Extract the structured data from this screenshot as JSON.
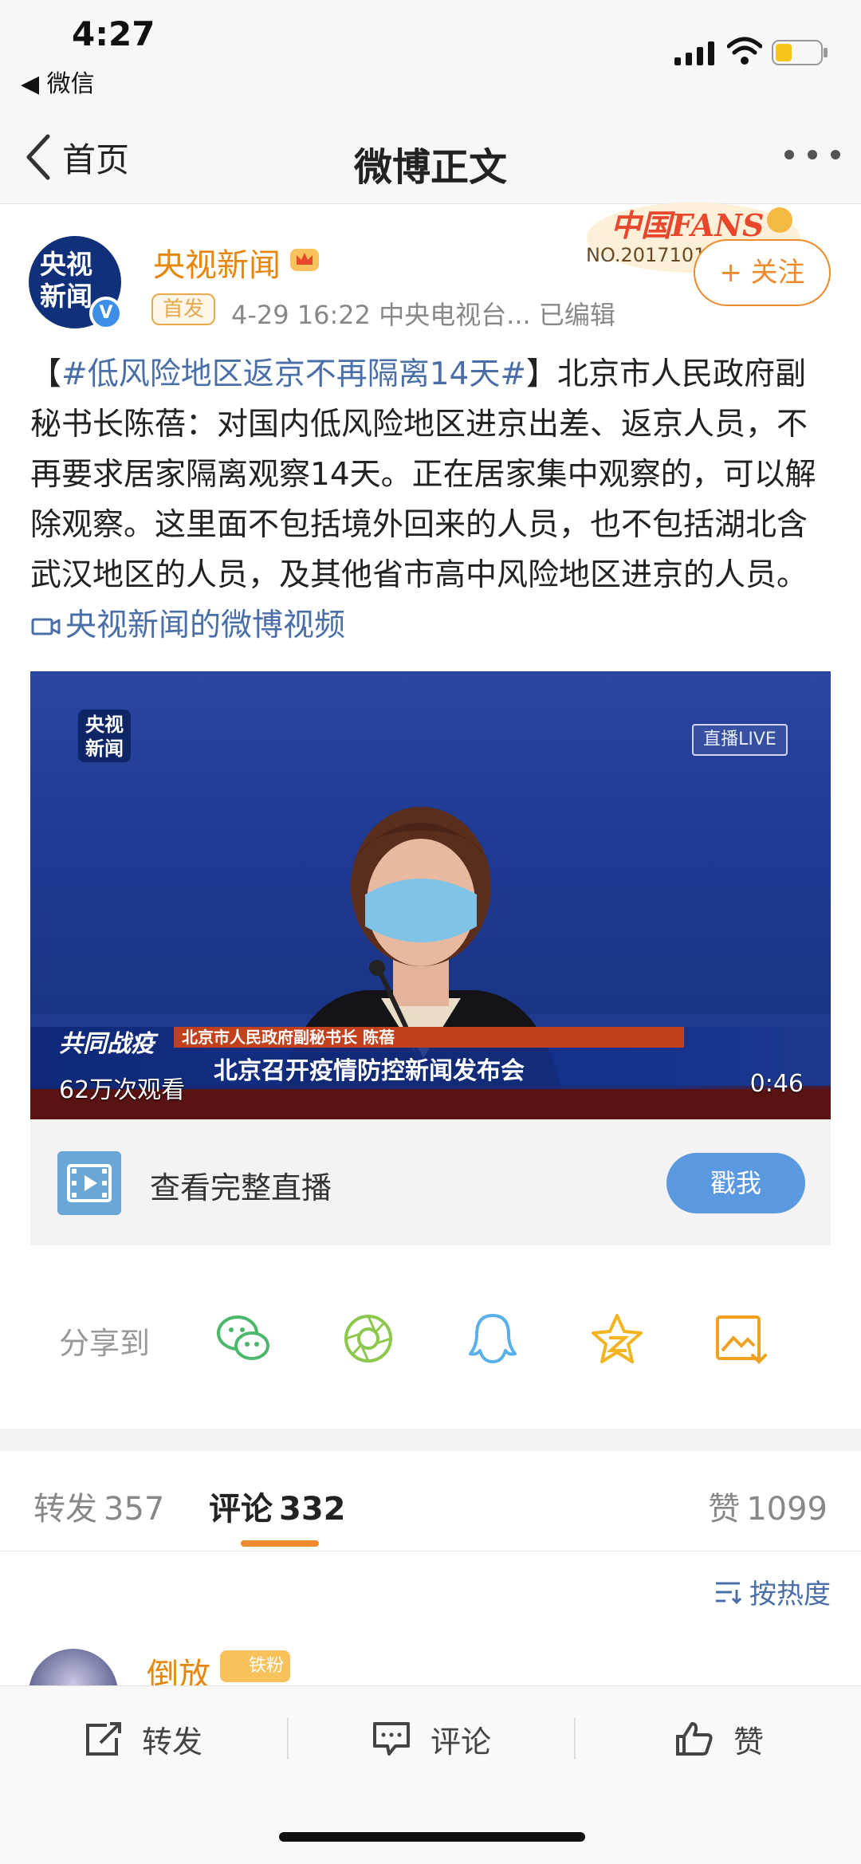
{
  "status": {
    "time": "4:27",
    "back_app": "◀ 微信"
  },
  "nav": {
    "back_label": "首页",
    "title": "微博正文"
  },
  "post": {
    "avatar_text": "央视新闻",
    "user_name": "央视新闻",
    "fans_badge_title": "中国FANS",
    "fans_badge_no": "NO.2017101",
    "follow_label": "+ 关注",
    "first_tag": "首发",
    "meta": "4-29 16:22  中央电视台...  已编辑",
    "text_open": "【",
    "hashtag": "#低风险地区返京不再隔离14天#",
    "text_close": "】北京市人民政府副秘书长陈蓓：对国内低风险地区进京出差、返京人员，不再要求居家隔离观察14天。正在居家集中观察的，可以解除观察。这里面不包括境外回来的人员，也不包括湖北含武汉地区的人员，及其他省市高中风险地区进京的人员。",
    "video_link": "央视新闻的微博视频"
  },
  "video": {
    "logo": "央视新闻",
    "live_tag": "直播LIVE",
    "lower_third_top": "北京市人民政府副秘书长 陈蓓",
    "lower_third_main": "北京召开疫情防控新闻发布会",
    "campaign": "共同战疫",
    "views": "62万次观看",
    "duration": "0:46"
  },
  "live_card": {
    "label": "查看完整直播",
    "button": "戳我"
  },
  "share": {
    "label": "分享到",
    "icons": [
      "wechat-icon",
      "moments-icon",
      "qq-icon",
      "qzone-icon",
      "save-image-icon"
    ]
  },
  "tabs": {
    "repost_label": "转发",
    "repost_count": "357",
    "comment_label": "评论",
    "comment_count": "332",
    "like_label": "赞",
    "like_count": "1099"
  },
  "sort_label": "按热度",
  "comment": {
    "user_name": "倒放",
    "badge": "铁粉"
  },
  "bottom": {
    "repost": "转发",
    "comment": "评论",
    "like": "赞"
  },
  "colors": {
    "accent_orange": "#f08a2a",
    "link_blue": "#4a6fa8",
    "name_orange": "#e8860c",
    "live_button": "#5a98e0"
  }
}
